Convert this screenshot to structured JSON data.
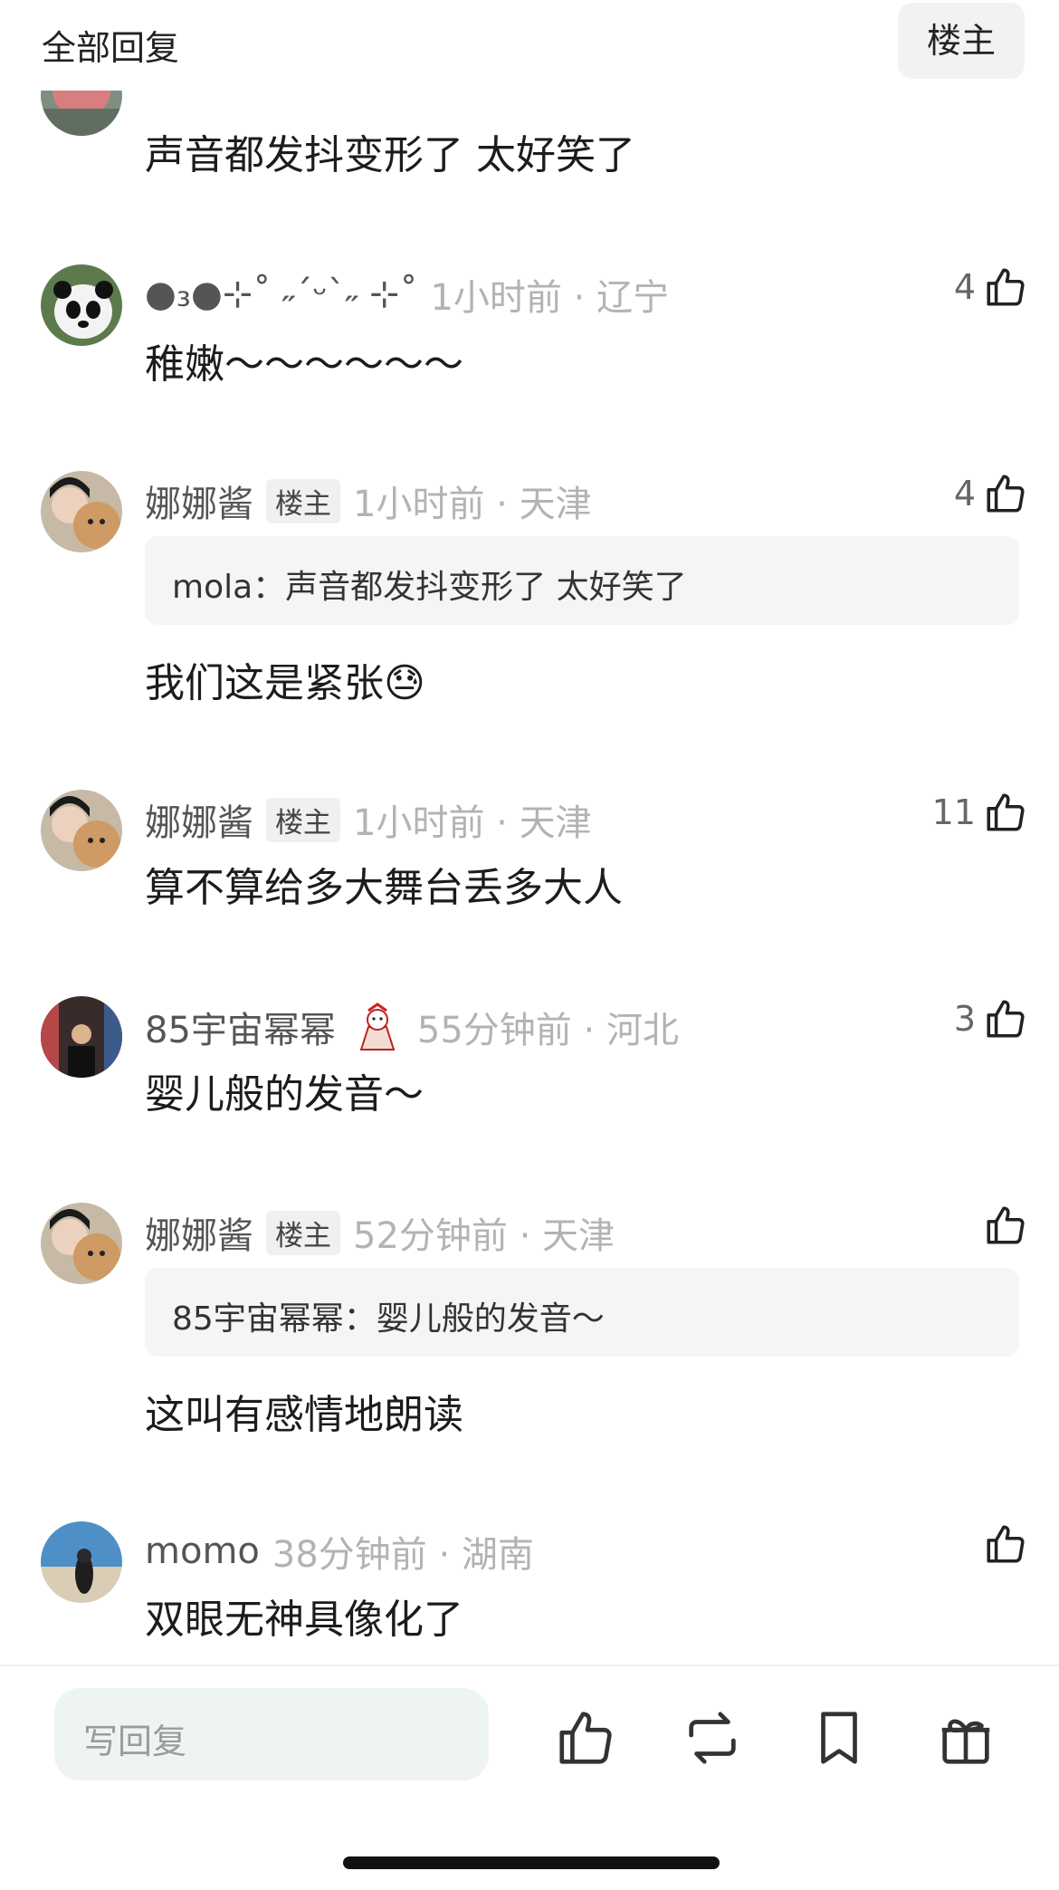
{
  "header": {
    "title": "全部回复",
    "op_filter": "楼主"
  },
  "comments": [
    {
      "text": "声音都发抖变形了 太好笑了"
    },
    {
      "username": "●₃●⊹˚ ˶ˊᵕˋ˶ ⊹˚",
      "time_loc": "1小时前 · 辽宁",
      "likes": "4",
      "text": "稚嫩～～～～～～"
    },
    {
      "username": "娜娜酱",
      "badge": "楼主",
      "time_loc": "1小时前 · 天津",
      "likes": "4",
      "quote": "mola：声音都发抖变形了 太好笑了",
      "text": "我们这是紧张😓"
    },
    {
      "username": "娜娜酱",
      "badge": "楼主",
      "time_loc": "1小时前 · 天津",
      "likes": "11",
      "text": "算不算给多大舞台丢多大人"
    },
    {
      "username": "85宇宙幂幂",
      "time_loc": "55分钟前 · 河北",
      "likes": "3",
      "text": "婴儿般的发音～"
    },
    {
      "username": "娜娜酱",
      "badge": "楼主",
      "time_loc": "52分钟前 · 天津",
      "likes": "",
      "quote": "85宇宙幂幂：婴儿般的发音～",
      "text": "这叫有感情地朗读"
    },
    {
      "username": "momo",
      "time_loc": "38分钟前 · 湖南",
      "likes": "",
      "text": "双眼无神具像化了"
    }
  ],
  "bottom_bar": {
    "reply_placeholder": "写回复",
    "icons": [
      "thumbs-up-icon",
      "repost-icon",
      "bookmark-icon",
      "gift-icon"
    ]
  },
  "colors": {
    "meta_gray": "#b3b3b3",
    "username_gray": "#555555",
    "input_bg": "#eef5f1"
  }
}
